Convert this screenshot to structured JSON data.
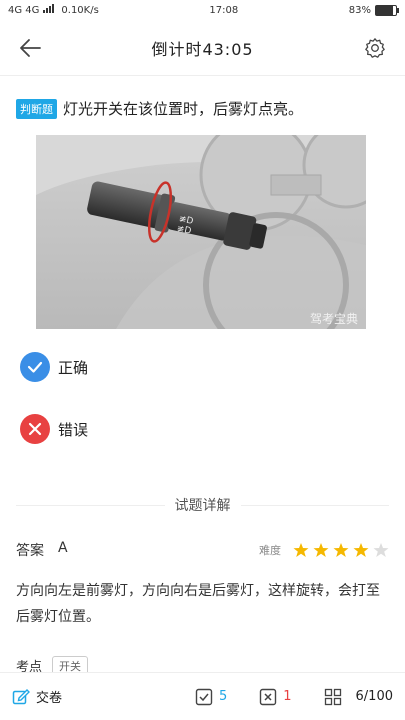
{
  "status": {
    "network": "4G 4G",
    "speed": "0.10K/s",
    "time": "17:08",
    "battery": "83%",
    "battery_level": 0.83
  },
  "header": {
    "title": "倒计时43:05"
  },
  "question": {
    "type_badge": "判断题",
    "text": "灯光开关在该位置时，后雾灯点亮。",
    "image_watermark": "驾考宝典"
  },
  "options": [
    {
      "label": "正确",
      "icon": "check-icon",
      "color": "#3a8ee6"
    },
    {
      "label": "错误",
      "icon": "close-icon",
      "color": "#e84141"
    }
  ],
  "details": {
    "section_title": "试题详解",
    "answer_label": "答案",
    "answer_value": "A",
    "difficulty_label": "难度",
    "difficulty_stars": 4,
    "difficulty_max": 5,
    "explanation": "方向向左是前雾灯，方向向右是后雾灯，这样旋转，会打至后雾灯位置。",
    "points_label": "考点",
    "points_tag": "开关"
  },
  "bottom_bar": {
    "submit_label": "交卷",
    "correct_count": "5",
    "wrong_count": "1",
    "progress": "6/100"
  },
  "colors": {
    "accent": "#1fa7e6",
    "correct": "#3a8ee6",
    "wrong": "#e84141",
    "star": "#f5b800"
  }
}
